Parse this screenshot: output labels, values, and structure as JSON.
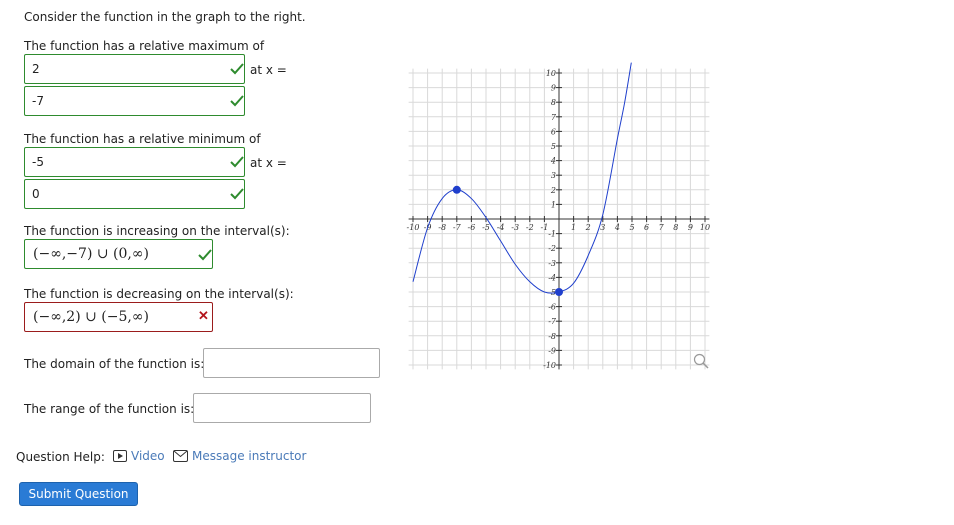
{
  "intro": "Consider the function in the graph to the right.",
  "max_label": "The function has a relative maximum of",
  "max_value": "2",
  "at_x_label": "at x =",
  "max_x": "-7",
  "min_label": "The function has a relative minimum of",
  "min_value": "-5",
  "min_x": "0",
  "increasing_label": "The function is increasing on the interval(s):",
  "increasing_value": "(−∞,−7) ∪ (0,∞)",
  "decreasing_label": "The function is decreasing on the interval(s):",
  "decreasing_value": "(−∞,2) ∪ (−5,∞)",
  "domain_label": "The domain of the function is:",
  "domain_value": "",
  "range_label": "The range of the function is:",
  "range_value": "",
  "help_label": "Question Help:",
  "video_label": "Video",
  "message_label": "Message instructor",
  "submit_label": "Submit Question",
  "colors": {
    "correct": "#2e8b2e",
    "incorrect": "#b3141c",
    "curve": "#1f3fcc",
    "button": "#2a7bd5"
  },
  "chart_data": {
    "type": "line",
    "title": "",
    "xlabel": "",
    "ylabel": "",
    "xlim": [
      -10,
      10
    ],
    "ylim": [
      -10,
      10
    ],
    "grid": true,
    "x_ticks": [
      -10,
      -9,
      -8,
      -7,
      -6,
      -5,
      -4,
      -3,
      -2,
      -1,
      1,
      2,
      3,
      4,
      5,
      6,
      7,
      8,
      9,
      10
    ],
    "y_ticks": [
      -10,
      -9,
      -8,
      -7,
      -6,
      -5,
      -4,
      -3,
      -2,
      -1,
      1,
      2,
      3,
      4,
      5,
      6,
      7,
      8,
      9,
      10
    ],
    "series": [
      {
        "x": [
          -10,
          -9,
          -8,
          -7,
          -6,
          -5,
          -4,
          -3,
          -2,
          -1,
          0,
          1,
          2,
          3,
          4,
          4.5,
          5
        ],
        "y": [
          -4.3,
          -0.6,
          1.4,
          2,
          1.4,
          0.1,
          -1.5,
          -3.1,
          -4.3,
          -5,
          -5,
          -4.4,
          -2.5,
          0.3,
          5.5,
          8,
          11
        ]
      }
    ],
    "points": [
      {
        "x": -7,
        "y": 2
      },
      {
        "x": 0,
        "y": -5
      }
    ]
  }
}
